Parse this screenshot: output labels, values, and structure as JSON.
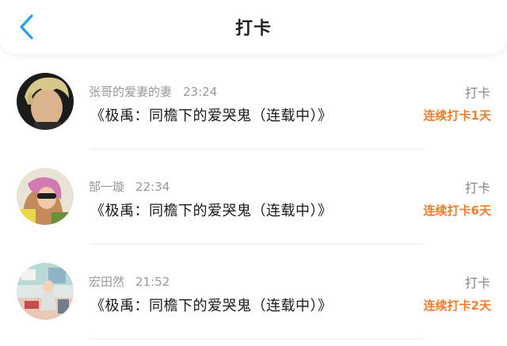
{
  "header": {
    "title": "打卡",
    "back_icon": "chevron-left-icon",
    "accent_color": "#2a9ff0"
  },
  "colors": {
    "streak": "#f47c2b",
    "meta": "#999999"
  },
  "items": [
    {
      "user": "张哥的爱妻的妻",
      "time": "23:24",
      "book": "《极禹：同檐下的爱哭鬼（连载中）》",
      "type": "打卡",
      "streak": "连续打卡1天"
    },
    {
      "user": "郜一璇",
      "time": "22:34",
      "book": "《极禹：同檐下的爱哭鬼（连载中）》",
      "type": "打卡",
      "streak": "连续打卡6天"
    },
    {
      "user": "宏田然",
      "time": "21:52",
      "book": "《极禹：同檐下的爱哭鬼（连载中）》",
      "type": "打卡",
      "streak": "连续打卡2天"
    }
  ]
}
